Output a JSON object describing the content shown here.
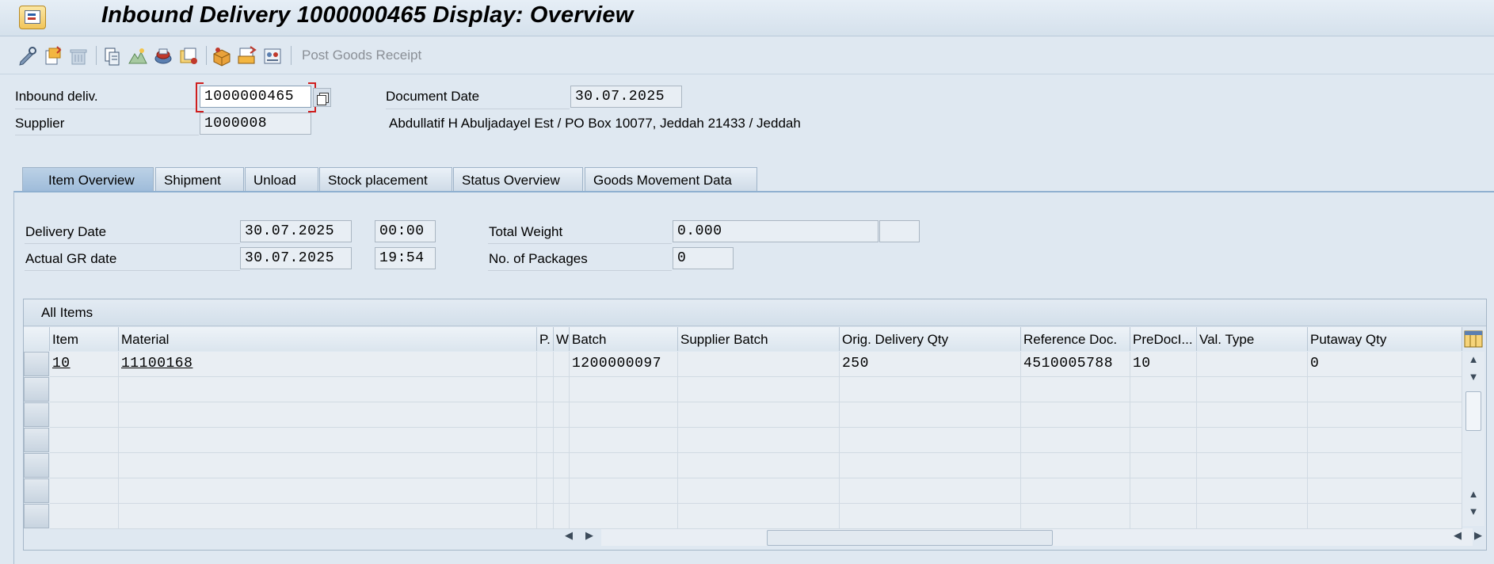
{
  "window": {
    "title": "Inbound Delivery 1000000465 Display: Overview"
  },
  "toolbar": {
    "post_goods_receipt": "Post Goods Receipt",
    "icons": [
      "display-change-icon",
      "other-object-icon",
      "delete-icon",
      "copy-document-icon",
      "header-icon",
      "items-icon",
      "partner-icon",
      "packing-icon",
      "output-icon",
      "settings-icon"
    ]
  },
  "header": {
    "inbound_deliv_label": "Inbound deliv.",
    "inbound_deliv_value": "1000000465",
    "supplier_label": "Supplier",
    "supplier_value": "1000008",
    "document_date_label": "Document Date",
    "document_date_value": "30.07.2025",
    "supplier_address": "Abdullatif H Abuljadayel Est / PO Box 10077, Jeddah 21433 / Jeddah"
  },
  "tabs": [
    "Item Overview",
    "Shipment",
    "Unload",
    "Stock placement",
    "Status Overview",
    "Goods Movement Data"
  ],
  "overview": {
    "delivery_date_label": "Delivery Date",
    "delivery_date_value": "30.07.2025",
    "delivery_time_value": "00:00",
    "actual_gr_date_label": "Actual GR date",
    "actual_gr_date_value": "30.07.2025",
    "actual_gr_time_value": "19:54",
    "total_weight_label": "Total Weight",
    "total_weight_value": "0.000",
    "total_weight_unit": "",
    "packages_label": "No. of Packages",
    "packages_value": "0"
  },
  "items_table": {
    "title": "All Items",
    "columns": [
      "Item",
      "Material",
      "P.",
      "W",
      "Batch",
      "Supplier Batch",
      "Orig. Delivery Qty",
      "Reference Doc.",
      "PreDocI...",
      "Val. Type",
      "Putaway Qty"
    ],
    "rows": [
      [
        "10",
        "11100168",
        "",
        "",
        "1200000097",
        "",
        "250",
        "4510005788",
        "10",
        "",
        "0"
      ]
    ]
  },
  "colors": {
    "background": "#dfe8f1",
    "active_tab": "#9fbcda",
    "focus_red": "#cf1f1f"
  }
}
